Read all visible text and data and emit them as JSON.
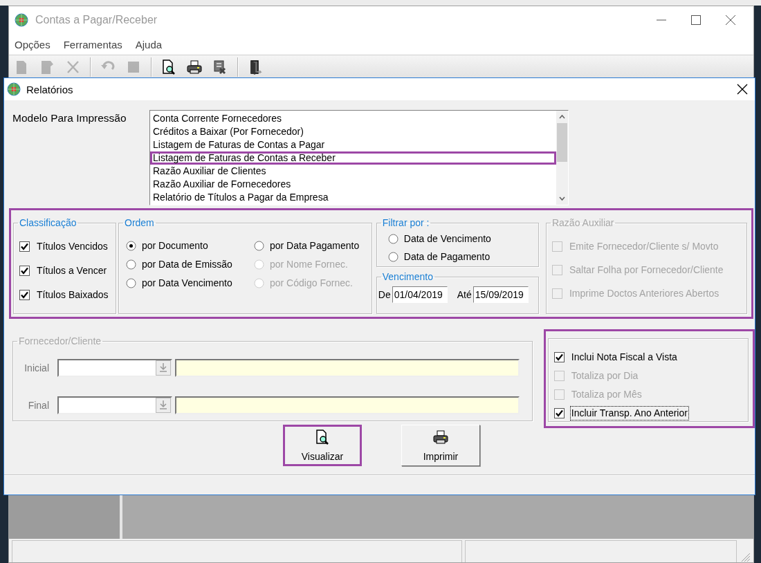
{
  "main_window": {
    "title": "Contas a Pagar/Receber",
    "menu": [
      {
        "label": "Opções"
      },
      {
        "label": "Ferramentas"
      },
      {
        "label": "Ajuda"
      }
    ],
    "toolbar": [
      {
        "kind": "new",
        "disabled": true
      },
      {
        "kind": "edit",
        "disabled": true
      },
      {
        "kind": "delete",
        "disabled": true
      },
      {
        "kind": "separator"
      },
      {
        "kind": "undo",
        "disabled": true
      },
      {
        "kind": "stop",
        "disabled": true
      },
      {
        "kind": "separator"
      },
      {
        "kind": "preview",
        "disabled": false
      },
      {
        "kind": "print",
        "disabled": false
      },
      {
        "kind": "tools",
        "disabled": false
      },
      {
        "kind": "separator"
      },
      {
        "kind": "exit",
        "disabled": false
      }
    ]
  },
  "dialog": {
    "title": "Relatórios",
    "model_label": "Modelo Para Impressão",
    "models": [
      {
        "label": "Conta Corrente Fornecedores",
        "highlighted": false
      },
      {
        "label": "Créditos a Baixar (Por Fornecedor)",
        "highlighted": false
      },
      {
        "label": "Listagem de Faturas de Contas a Pagar",
        "highlighted": false
      },
      {
        "label": "Listagem de Faturas de Contas a Receber",
        "highlighted": true
      },
      {
        "label": "Razão Auxiliar de Clientes",
        "highlighted": false
      },
      {
        "label": "Razão Auxiliar de Fornecedores",
        "highlighted": false
      },
      {
        "label": "Relatório de Títulos a Pagar da Empresa",
        "highlighted": false
      }
    ],
    "options_panel": {
      "highlighted": true,
      "classificacao": {
        "title": "Classificação",
        "disabled": false,
        "items": [
          {
            "label": "Títulos Vencidos",
            "checked": true,
            "disabled": false
          },
          {
            "label": "Títulos a Vencer",
            "checked": true,
            "disabled": false
          },
          {
            "label": "Títulos Baixados",
            "checked": true,
            "disabled": false
          }
        ]
      },
      "ordem": {
        "title": "Ordem",
        "disabled": false,
        "options": [
          {
            "label": "por Documento",
            "selected": true,
            "disabled": false
          },
          {
            "label": "por Data Pagamento",
            "selected": false,
            "disabled": false
          },
          {
            "label": "por Data de Emissão",
            "selected": false,
            "disabled": false
          },
          {
            "label": "por Nome Fornec.",
            "selected": false,
            "disabled": true
          },
          {
            "label": "por Data Vencimento",
            "selected": false,
            "disabled": false
          },
          {
            "label": "por Código Fornec.",
            "selected": false,
            "disabled": true
          }
        ]
      },
      "filtrar_por": {
        "title": "Filtrar por :",
        "disabled": false,
        "options": [
          {
            "label": "Data de Vencimento",
            "selected": false,
            "disabled": false
          },
          {
            "label": "Data de Pagamento",
            "selected": false,
            "disabled": false
          }
        ]
      },
      "vencimento": {
        "title": "Vencimento",
        "disabled": false,
        "from_label": "De",
        "from": "01/04/2019",
        "to_label": "Até",
        "to": "15/09/2019"
      },
      "razao_auxiliar": {
        "title": "Razão Auxiliar",
        "disabled": true,
        "items": [
          {
            "label": "Emite Fornecedor/Cliente s/ Movto",
            "checked": false,
            "disabled": true
          },
          {
            "label": "Saltar Folha por Fornecedor/Cliente",
            "checked": false,
            "disabled": true
          },
          {
            "label": "Imprime Doctos Anteriores Abertos",
            "checked": false,
            "disabled": true
          }
        ]
      }
    },
    "fornecedor_cliente": {
      "title": "Fornecedor/Cliente",
      "disabled": true,
      "rows": [
        {
          "label": "Inicial"
        },
        {
          "label": "Final"
        }
      ]
    },
    "extras": {
      "highlighted": true,
      "items": [
        {
          "label": "Inclui Nota Fiscal  a Vista",
          "checked": true,
          "disabled": false,
          "focused": false
        },
        {
          "label": "Totaliza por Dia",
          "checked": false,
          "disabled": true,
          "focused": false
        },
        {
          "label": "Totaliza por Mês",
          "checked": false,
          "disabled": true,
          "focused": false
        },
        {
          "label": "Incluir Transp. Ano Anterior",
          "checked": true,
          "disabled": false,
          "focused": true
        }
      ]
    },
    "buttons": [
      {
        "label": "Visualizar",
        "kind": "preview",
        "highlighted": true
      },
      {
        "label": "Imprimir",
        "kind": "print",
        "highlighted": false
      }
    ]
  }
}
